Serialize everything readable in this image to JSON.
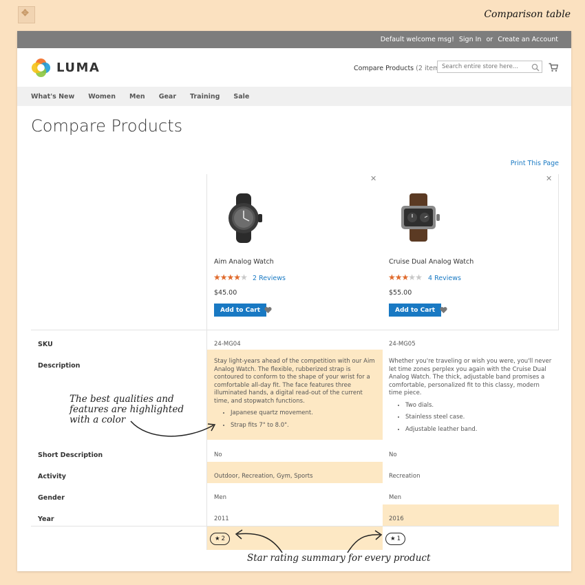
{
  "caption": "Comparison table",
  "header": {
    "welcome": "Default welcome msg!",
    "sign_in": "Sign In",
    "or": "or",
    "create_account": "Create an Account"
  },
  "brand": {
    "name": "LUMA"
  },
  "compare": {
    "label": "Compare Products",
    "count": "(2 items)"
  },
  "search": {
    "placeholder": "Search entire store here..."
  },
  "nav": [
    "What's New",
    "Women",
    "Men",
    "Gear",
    "Training",
    "Sale"
  ],
  "page_title": "Compare Products",
  "print_label": "Print This Page",
  "products": [
    {
      "name": "Aim Analog Watch",
      "rating": 0.8,
      "reviews": "2 Reviews",
      "price": "$45.00",
      "add_to_cart": "Add to Cart",
      "sku": "24-MG04",
      "description": "Stay light-years ahead of the competition with our Aim Analog Watch. The flexible, rubberized strap is contoured to conform to the shape of your wrist for a comfortable all-day fit. The face features three illuminated hands, a digital read-out of the current time, and stopwatch functions.",
      "features": [
        "Japanese quartz movement.",
        "Strap fits 7\" to 8.0\"."
      ],
      "short_description": "No",
      "activity": "Outdoor, Recreation, Gym, Sports",
      "gender": "Men",
      "year": "2011",
      "star_count": "2"
    },
    {
      "name": "Cruise Dual Analog Watch",
      "rating": 0.6,
      "reviews": "4 Reviews",
      "price": "$55.00",
      "add_to_cart": "Add to Cart",
      "sku": "24-MG05",
      "description": "Whether you're traveling or wish you were, you'll never let time zones perplex you again with the Cruise Dual Analog Watch. The thick, adjustable band promises a comfortable, personalized fit to this classy, modern time piece.",
      "features": [
        "Two dials.",
        "Stainless steel case.",
        "Adjustable leather band."
      ],
      "short_description": "No",
      "activity": "Recreation",
      "gender": "Men",
      "year": "2016",
      "star_count": "1"
    }
  ],
  "rows": {
    "sku": "SKU",
    "description": "Description",
    "short_description": "Short Description",
    "activity": "Activity",
    "gender": "Gender",
    "year": "Year"
  },
  "annotations": {
    "highlight_note": "The best qualities and features are highlighted with a color",
    "star_note": "Star rating summary for every product"
  },
  "colors": {
    "highlight": "#fde8c4",
    "primary": "#1979c3",
    "star": "#e06b2d",
    "background": "#fbe1c0"
  }
}
